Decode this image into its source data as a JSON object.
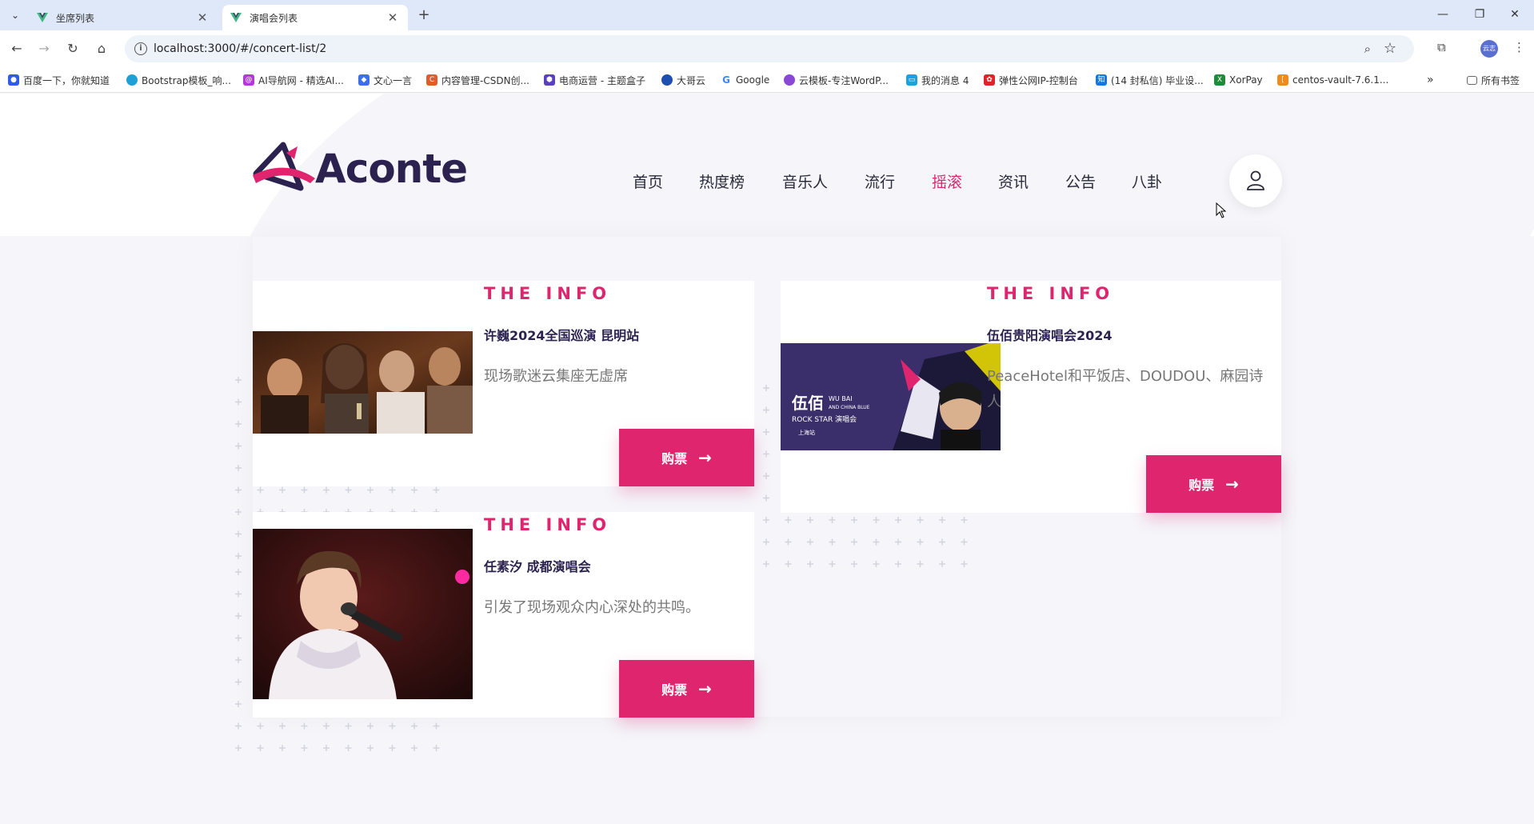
{
  "browser": {
    "tabs": [
      {
        "title": "坐席列表",
        "active": false
      },
      {
        "title": "演唱会列表",
        "active": true
      }
    ],
    "url": "localhost:3000/#/concert-list/2",
    "profile_label": "云志",
    "bookmarks": [
      {
        "label": "百度一下，你就知道",
        "color": "#2f5bea",
        "icon": "paw-icon"
      },
      {
        "label": "Bootstrap模板_响...",
        "color": "#1e9fd6",
        "icon": "bootstrap-icon"
      },
      {
        "label": "AI导航网 - 精选AI...",
        "color": "#b03ad8",
        "icon": "ai-icon"
      },
      {
        "label": "文心一言",
        "color": "#3b6ee8",
        "icon": "wenxin-icon"
      },
      {
        "label": "内容管理-CSDN创...",
        "color": "#e35b2b",
        "icon": "csdn-icon"
      },
      {
        "label": "电商运营 - 主题盒子",
        "color": "#5a3fc0",
        "icon": "shop-icon"
      },
      {
        "label": "大哥云",
        "color": "#1c4fb0",
        "icon": "cloud-icon"
      },
      {
        "label": "Google",
        "color": "#4285f4",
        "icon": "google-icon"
      },
      {
        "label": "云模板-专注WordP...",
        "color": "#8a47d6",
        "icon": "template-icon"
      },
      {
        "label": "我的消息 4",
        "color": "#1aa1e0",
        "icon": "bilibili-icon"
      },
      {
        "label": "弹性公网IP-控制台",
        "color": "#e0232a",
        "icon": "huawei-icon"
      },
      {
        "label": "(14 封私信) 毕业设...",
        "color": "#1675e0",
        "icon": "zhihu-icon"
      },
      {
        "label": "XorPay",
        "color": "#1f8a3a",
        "icon": "xorpay-icon"
      },
      {
        "label": "centos-vault-7.6.1...",
        "color": "#f08a1d",
        "icon": "code-icon"
      }
    ],
    "all_bookmarks": "所有书签"
  },
  "site": {
    "logo_text": "Aconte",
    "nav": [
      {
        "label": "首页",
        "active": false
      },
      {
        "label": "热度榜",
        "active": false
      },
      {
        "label": "音乐人",
        "active": false
      },
      {
        "label": "流行",
        "active": false
      },
      {
        "label": "摇滚",
        "active": true
      },
      {
        "label": "资讯",
        "active": false
      },
      {
        "label": "公告",
        "active": false
      },
      {
        "label": "八卦",
        "active": false
      }
    ]
  },
  "concerts": [
    {
      "label": "THE INFO",
      "title": "许巍2024全国巡演 昆明站",
      "description": "现场歌迷云集座无虚席",
      "buy_label": "购票",
      "image": "crowd-photo"
    },
    {
      "label": "THE INFO",
      "title": "伍佰贵阳演唱会2024",
      "description": "PeaceHotel和平饭店、DOUDOU、麻园诗人",
      "buy_label": "购票",
      "image": "poster-wubai",
      "poster_text": {
        "cn": "伍佰",
        "en1": "WU BAI",
        "en2": "AND CHINA BLUE",
        "line": "ROCK STAR 演唱会",
        "loc": "上海站"
      }
    },
    {
      "label": "THE INFO",
      "title": "任素汐 成都演唱会",
      "description": "引发了现场观众内心深处的共鸣。",
      "buy_label": "购票",
      "image": "singer-photo"
    }
  ],
  "colors": {
    "accent": "#e0256f",
    "brand_dark": "#2b2250",
    "page_bg": "#f5f5fa"
  }
}
